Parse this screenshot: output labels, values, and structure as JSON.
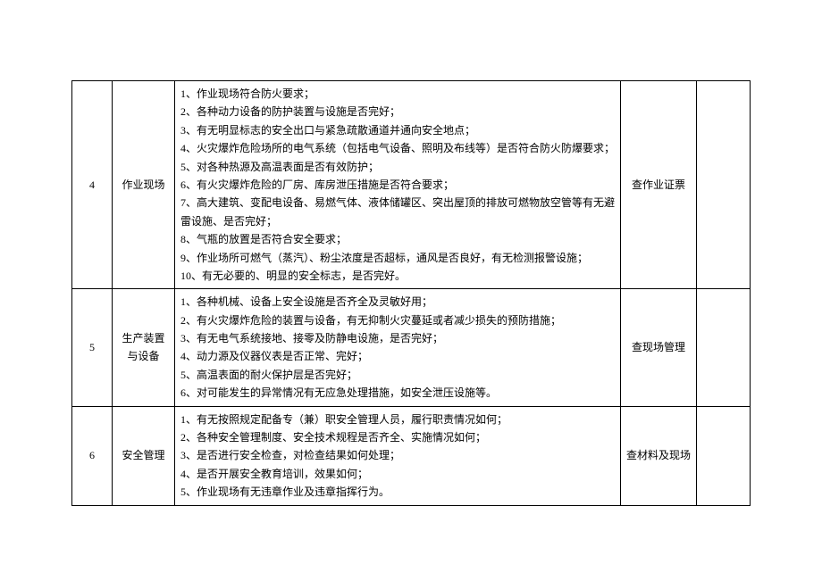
{
  "rows": [
    {
      "num": "4",
      "category": "作业现场",
      "items": [
        "1、作业现场符合防火要求；",
        "2、各种动力设备的防护装置与设施是否完好；",
        "3、有无明显标志的安全出口与紧急疏散通道并通向安全地点；",
        "4、火灾爆炸危险场所的电气系统（包括电气设备、照明及布线等）是否符合防火防爆要求；",
        "5、对各种热源及高温表面是否有效防护；",
        "6、有火灾爆炸危险的厂房、库房泄压措施是否符合要求；",
        "7、高大建筑、变配电设备、易燃气体、液体储罐区、突出屋顶的排放可燃物放空管等有无避雷设施、是否完好；",
        "8、气瓶的放置是否符合安全要求；",
        "9、作业场所可燃气（蒸汽）、粉尘浓度是否超标，通风是否良好，有无检测报警设施；",
        "10、有无必要的、明显的安全标志，是否完好。"
      ],
      "method": "查作业证票"
    },
    {
      "num": "5",
      "category": "生产装置与设备",
      "items": [
        "1、各种机械、设备上安全设施是否齐全及灵敏好用；",
        "2、有火灾爆炸危险的装置与设备，有无抑制火灾蔓延或者减少损失的预防措施；",
        "3、有无电气系统接地、接零及防静电设施，是否完好；",
        "4、动力源及仪器仪表是否正常、完好；",
        "5、高温表面的耐火保护层是否完好；",
        "6、对可能发生的异常情况有无应急处理措施，如安全泄压设施等。"
      ],
      "method": "查现场管理"
    },
    {
      "num": "6",
      "category": "安全管理",
      "items": [
        "1、有无按照规定配备专（兼）职安全管理人员，履行职责情况如何；",
        "2、各种安全管理制度、安全技术规程是否齐全、实施情况如何；",
        "3、是否进行安全检查，对检查结果如何处理；",
        "4、是否开展安全教育培训，效果如何；",
        "5、作业现场有无违章作业及违章指挥行为。"
      ],
      "method": "查材料及现场"
    }
  ]
}
